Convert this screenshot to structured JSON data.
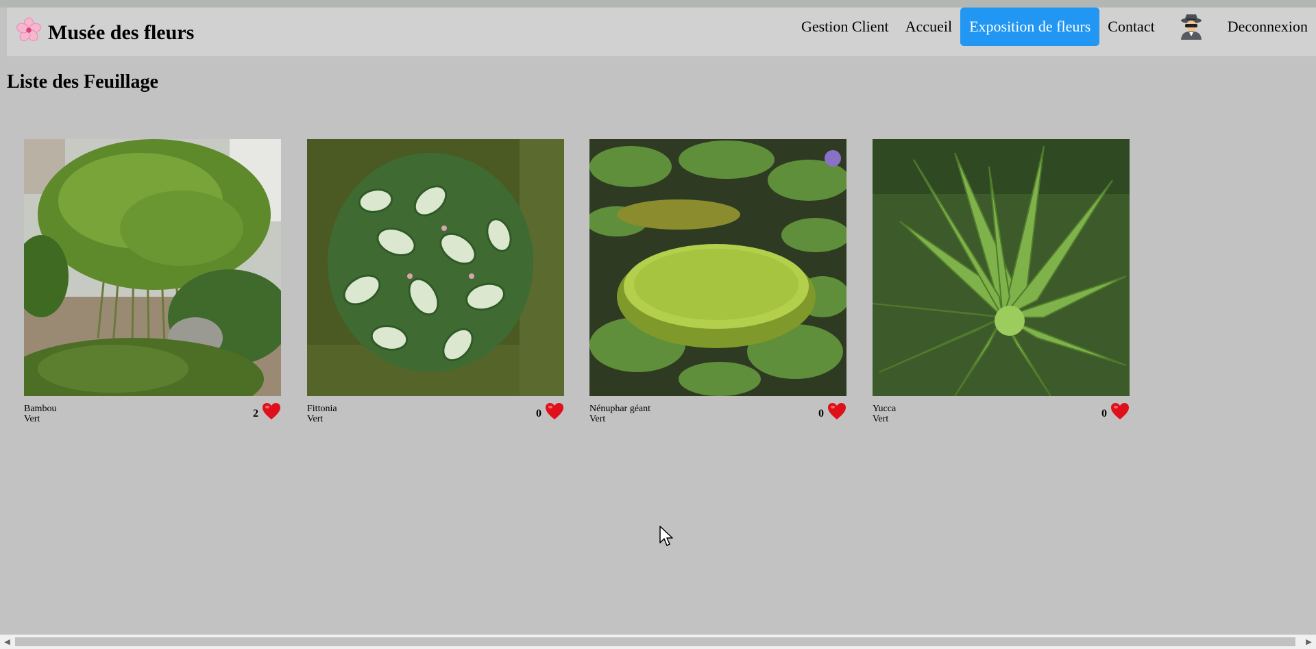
{
  "app": {
    "title": "Musée des fleurs",
    "logo_icon": "cherry-blossom-icon"
  },
  "nav": {
    "items": [
      {
        "label": "Gestion Client"
      },
      {
        "label": "Accueil"
      },
      {
        "label": "Exposition de fleurs",
        "active": true
      },
      {
        "label": "Contact"
      }
    ],
    "user_icon": "spy-avatar-icon",
    "logout_label": "Deconnexion"
  },
  "page": {
    "title": "Liste des Feuillage"
  },
  "plants": [
    {
      "name": "Bambou",
      "color": "Vert",
      "likes": "2",
      "photo": "bamboo-photo"
    },
    {
      "name": "Fittonia",
      "color": "Vert",
      "likes": "0",
      "photo": "fittonia-photo"
    },
    {
      "name": "Nénuphar géant",
      "color": "Vert",
      "likes": "0",
      "photo": "giant-waterlily-photo"
    },
    {
      "name": "Yucca",
      "color": "Vert",
      "likes": "0",
      "photo": "yucca-photo"
    }
  ],
  "colors": {
    "page_bg": "#c2c2c2",
    "navbar_bg": "#d1d1d1",
    "accent": "#2196f3",
    "heart": "#e0101b"
  },
  "icons": [
    "cherry-blossom-icon",
    "spy-avatar-icon",
    "heart-icon",
    "mouse-cursor-icon",
    "scroll-left-icon",
    "scroll-right-icon"
  ]
}
